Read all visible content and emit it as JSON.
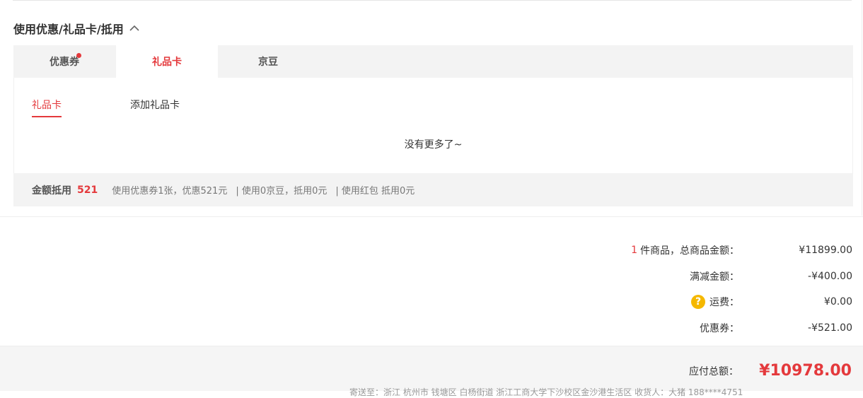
{
  "section": {
    "title": "使用优惠/礼品卡/抵用"
  },
  "tabs": [
    {
      "label": "优惠券",
      "has_dot": true
    },
    {
      "label": "礼品卡",
      "active": true
    },
    {
      "label": "京豆"
    }
  ],
  "panel": {
    "subtabs": [
      {
        "label": "礼品卡",
        "active": true
      },
      {
        "label": "添加礼品卡"
      }
    ],
    "empty_message": "没有更多了~"
  },
  "summary": {
    "label": "金额抵用",
    "amount": "521",
    "coupon_detail": "使用优惠券1张，优惠521元",
    "jingdou_detail": "| 使用0京豆，抵用0元",
    "hongbao_detail": "| 使用红包 抵用0元"
  },
  "totals": {
    "item_count": "1",
    "items_label": "件商品，总商品金额：",
    "items_value": "¥11899.00",
    "discount_label": "满减金额：",
    "discount_value": "-¥400.00",
    "shipping_label": "运费：",
    "shipping_value": "¥0.00",
    "coupon_label": "优惠券：",
    "coupon_value": "-¥521.00"
  },
  "payment": {
    "label": "应付总额：",
    "amount": "¥10978.00",
    "address_fragment": "寄送至：浙江 杭州市 钱塘区 白杨街道 浙江工商大学下沙校区金沙港生活区    收货人：大猪 188****4751"
  },
  "icons": {
    "chevron": "chevron-up-icon",
    "help": "help-icon"
  },
  "colors": {
    "accent": "#e4393c",
    "help_icon": "#f5b800"
  }
}
